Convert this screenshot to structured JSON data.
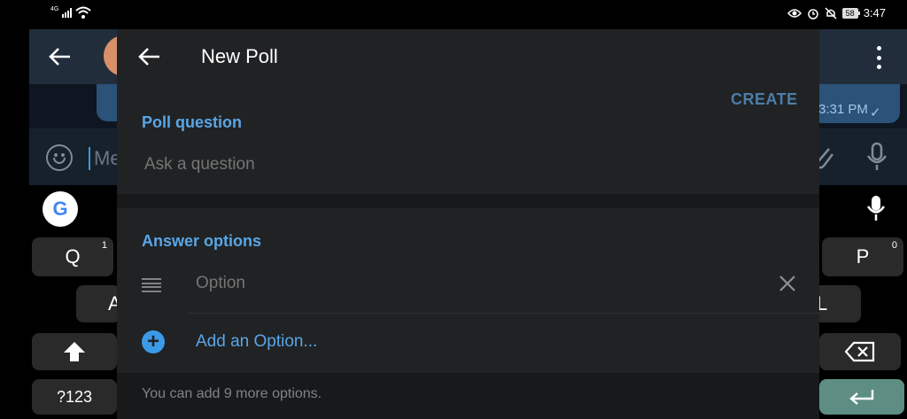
{
  "status_bar": {
    "network": "4G",
    "battery": "58",
    "time": "3:47"
  },
  "background_chat": {
    "message_time": "3:31 PM",
    "message_placeholder": "Me"
  },
  "keyboard": {
    "google_label": "G",
    "key_q": "Q",
    "key_q_hint": "1",
    "key_p": "P",
    "key_p_hint": "0",
    "key_a": "A",
    "key_l": "L",
    "key_numbers": "?123"
  },
  "dialog": {
    "title": "New Poll",
    "create_label": "CREATE",
    "question_section_title": "Poll question",
    "question_placeholder": "Ask a question",
    "answers_section_title": "Answer options",
    "option_placeholder": "Option",
    "add_option_label": "Add an Option...",
    "footer_note": "You can add 9 more options."
  },
  "colors": {
    "accent_blue": "#5aa6e6",
    "create_disabled": "#4c7da8",
    "dialog_background": "#202224",
    "enter_key": "#5e8e83"
  },
  "icons": [
    "back-arrow-icon",
    "close-icon",
    "drag-handle-icon",
    "plus-circle-icon",
    "emoji-icon",
    "attach-icon",
    "mic-icon",
    "shift-icon",
    "backspace-icon",
    "enter-icon",
    "eye-icon",
    "alarm-icon",
    "mute-icon",
    "wifi-icon",
    "signal-icon"
  ]
}
